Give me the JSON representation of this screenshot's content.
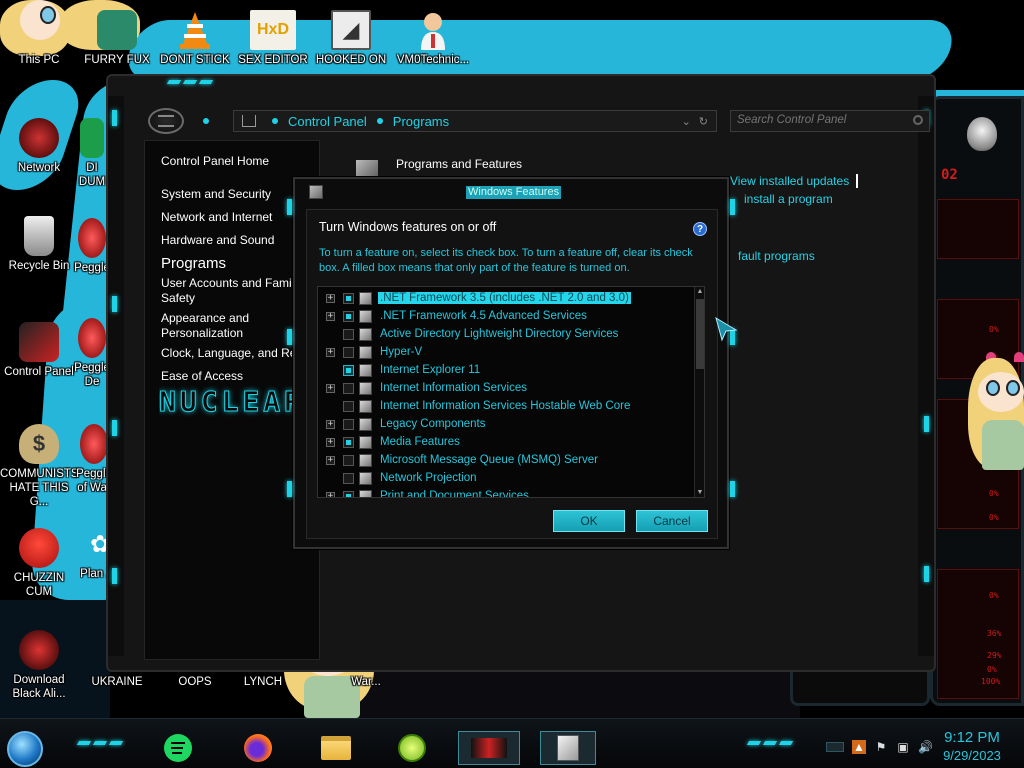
{
  "desktop": {
    "icons_top": [
      {
        "name": "this-pc-icon",
        "label": "This PC"
      },
      {
        "name": "furry-fux-icon",
        "label": "FURRY FUX"
      },
      {
        "name": "dont-stick-icon",
        "label": "DONT STICK"
      },
      {
        "name": "sex-editor-icon",
        "label": "SEX EDITOR"
      },
      {
        "name": "hooked-on-icon",
        "label": "HOOKED ON"
      },
      {
        "name": "vm0technic-icon",
        "label": "VM0Technic..."
      }
    ],
    "icons_left": [
      {
        "name": "network-icon",
        "label": "Network"
      },
      {
        "name": "recycle-bin-icon",
        "label": "Recycle Bin"
      },
      {
        "name": "control-panel-icon",
        "label": "Control Panel"
      },
      {
        "name": "communists-icon",
        "label": "COMMUNISTS HATE THIS G..."
      },
      {
        "name": "chuzzin-icon",
        "label": "CHUZZIN CUM"
      },
      {
        "name": "download-black-ali-icon",
        "label": "Download Black Ali..."
      }
    ],
    "icons_col2": [
      {
        "name": "dumb-icon",
        "label": "DI DUM"
      },
      {
        "name": "peggle-icon",
        "label": "Peggle"
      },
      {
        "name": "peggle-de-icon",
        "label": "Peggle De"
      },
      {
        "name": "peggle-of-war-icon",
        "label": "Peggle of War"
      },
      {
        "name": "plant-zombie-icon",
        "label": "Plan Zo"
      }
    ],
    "icons_bottom": [
      {
        "name": "ukraine-icon",
        "label": "UKRAINE"
      },
      {
        "name": "oops-icon",
        "label": "OOPS"
      },
      {
        "name": "lynch-icon",
        "label": "LYNCH"
      },
      {
        "name": "war-icon",
        "label": "War..."
      }
    ],
    "wallpaper_ornament_text": "02",
    "red_percent_labels": [
      "0%",
      "0%",
      "0%",
      "0%",
      "0%",
      "0%",
      "36%",
      "29%",
      "0%",
      "100%"
    ]
  },
  "control_panel": {
    "breadcrumb": [
      "Control Panel",
      "Programs"
    ],
    "search_placeholder": "Search Control Panel",
    "sidebar": {
      "home": "Control Panel Home",
      "items": [
        "System and Security",
        "Network and Internet",
        "Hardware and Sound",
        "Programs",
        "User Accounts and Family Safety",
        "Appearance and Personalization",
        "Clock, Language, and Region",
        "Ease of Access"
      ],
      "current": "Programs",
      "branding": "NUCLEAR"
    },
    "main": {
      "section_heading": "Programs and Features",
      "links": [
        "View installed updates",
        "install a program",
        "fault programs"
      ]
    }
  },
  "windows_features": {
    "title": "Windows Features",
    "heading": "Turn Windows features on or off",
    "description": "To turn a feature on, select its check box. To turn a feature off, clear its check box. A filled box means that only part of the feature is turned on.",
    "features": [
      {
        "label": ".NET Framework 3.5 (includes .NET 2.0 and 3.0)",
        "expandable": true,
        "state": "partial",
        "selected": true
      },
      {
        "label": ".NET Framework 4.5 Advanced Services",
        "expandable": true,
        "state": "partial",
        "selected": false
      },
      {
        "label": "Active Directory Lightweight Directory Services",
        "expandable": false,
        "state": "off",
        "selected": false
      },
      {
        "label": "Hyper-V",
        "expandable": true,
        "state": "off",
        "selected": false
      },
      {
        "label": "Internet Explorer 11",
        "expandable": false,
        "state": "on",
        "selected": false
      },
      {
        "label": "Internet Information Services",
        "expandable": true,
        "state": "off",
        "selected": false
      },
      {
        "label": "Internet Information Services Hostable Web Core",
        "expandable": false,
        "state": "off",
        "selected": false
      },
      {
        "label": "Legacy Components",
        "expandable": true,
        "state": "off",
        "selected": false
      },
      {
        "label": "Media Features",
        "expandable": true,
        "state": "partial",
        "selected": false
      },
      {
        "label": "Microsoft Message Queue (MSMQ) Server",
        "expandable": true,
        "state": "off",
        "selected": false
      },
      {
        "label": "Network Projection",
        "expandable": false,
        "state": "off",
        "selected": false
      },
      {
        "label": "Print and Document Services",
        "expandable": true,
        "state": "partial",
        "selected": false
      }
    ],
    "ok_label": "OK",
    "cancel_label": "Cancel"
  },
  "taskbar": {
    "pinned": [
      "spotify-icon",
      "firefox-icon",
      "file-explorer-icon",
      "lime-app-icon",
      "alienware-app-icon",
      "windows-features-task-icon"
    ],
    "time": "9:12 PM",
    "date": "9/29/2023"
  },
  "colors": {
    "accent_cyan": "#1fd3e6",
    "link_cyan": "#25c7dd",
    "wallpaper_cyan": "#25b6d9",
    "alert_red": "#d21b1b"
  }
}
